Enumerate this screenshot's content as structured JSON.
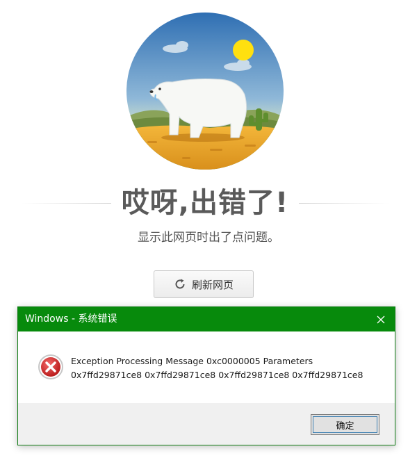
{
  "error_page": {
    "headline": "哎呀,出错了!",
    "subtitle": "显示此网页时出了点问题。",
    "refresh_label": "刷新网页",
    "illustration": "polar-bear-desert-scene",
    "colors": {
      "sky": "#3f7fbf",
      "sand": "#e8a92c",
      "sun": "#ffe00f"
    }
  },
  "dialog": {
    "title": "Windows - 系统错误",
    "message_line1": "Exception Processing Message 0xc0000005 Parameters",
    "message_line2": "0x7ffd29871ce8 0x7ffd29871ce8 0x7ffd29871ce8 0x7ffd29871ce8",
    "ok_label": "确定",
    "icons": {
      "error": "error-icon",
      "close": "close-icon"
    },
    "colors": {
      "titlebar": "#078a0c",
      "footer": "#f0f0f0"
    }
  }
}
